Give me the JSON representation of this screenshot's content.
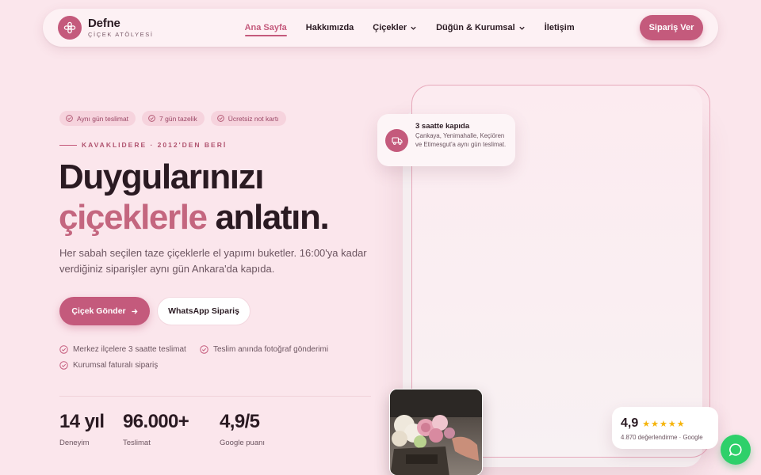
{
  "brand": {
    "name": "Defne",
    "tagline": "ÇİÇEK ATÖLYESİ"
  },
  "nav": {
    "items": [
      {
        "label": "Ana Sayfa",
        "active": true,
        "dropdown": false
      },
      {
        "label": "Hakkımızda",
        "active": false,
        "dropdown": false
      },
      {
        "label": "Çiçekler",
        "active": false,
        "dropdown": true
      },
      {
        "label": "Düğün & Kurumsal",
        "active": false,
        "dropdown": true
      },
      {
        "label": "İletişim",
        "active": false,
        "dropdown": false
      }
    ],
    "cta": "Sipariş Ver"
  },
  "hero": {
    "badges": [
      "Aynı gün teslimat",
      "7 gün tazelik",
      "Ücretsiz not kartı"
    ],
    "eyebrow": "KAVAKLIDERE · 2012'DEN BERİ",
    "title_line1": "Duygularınızı",
    "title_highlight": "çiçeklerle",
    "title_rest": " anlatın.",
    "description": "Her sabah seçilen taze çiçeklerle el yapımı buketler. 16:00'ya kadar verdiğiniz siparişler aynı gün Ankara'da kapıda.",
    "primary_button": "Çiçek Gönder",
    "secondary_button": "WhatsApp Sipariş",
    "features": [
      "Merkez ilçelere 3 saatte teslimat",
      "Teslim anında fotoğraf gönderimi",
      "Kurumsal faturalı sipariş"
    ],
    "stats": [
      {
        "value": "14 yıl",
        "label": "Deneyim"
      },
      {
        "value": "96.000+",
        "label": "Teslimat"
      },
      {
        "value": "4,9/5",
        "label": "Google puanı"
      }
    ]
  },
  "delivery_card": {
    "title": "3 saatte kapıda",
    "text": "Çankaya, Yenimahalle, Keçiören ve Etimesgut'a aynı gün teslimat."
  },
  "rating_card": {
    "score": "4,9",
    "stars": 5,
    "text": "4.870 değerlendirme · Google"
  },
  "colors": {
    "accent": "#c45a7c",
    "background": "#fbe6ec",
    "whatsapp": "#2ed06a",
    "star": "#f5b40b"
  }
}
